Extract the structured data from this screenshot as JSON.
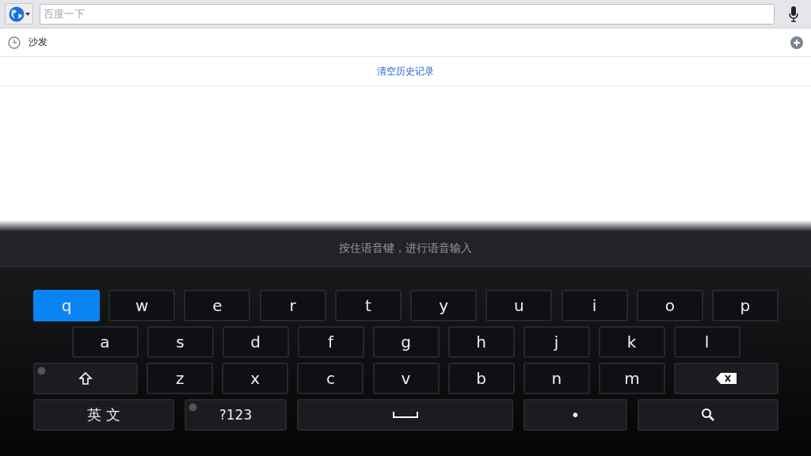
{
  "search_bar": {
    "placeholder": "百度一下"
  },
  "history": [
    {
      "text": "沙发"
    }
  ],
  "clear_history": "清空历史记录",
  "keyboard": {
    "hint": "按住语音键，进行语音输入",
    "rows": [
      {
        "keys": [
          {
            "kind": "letter",
            "label": "q",
            "pressed": true,
            "dot": false
          },
          {
            "kind": "letter",
            "label": "w",
            "pressed": false,
            "dot": false
          },
          {
            "kind": "letter",
            "label": "e",
            "pressed": false,
            "dot": false
          },
          {
            "kind": "letter",
            "label": "r",
            "pressed": false,
            "dot": false
          },
          {
            "kind": "letter",
            "label": "t",
            "pressed": false,
            "dot": false
          },
          {
            "kind": "letter",
            "label": "y",
            "pressed": false,
            "dot": false
          },
          {
            "kind": "letter",
            "label": "u",
            "pressed": false,
            "dot": false
          },
          {
            "kind": "letter",
            "label": "i",
            "pressed": false,
            "dot": false
          },
          {
            "kind": "letter",
            "label": "o",
            "pressed": false,
            "dot": false
          },
          {
            "kind": "letter",
            "label": "p",
            "pressed": false,
            "dot": false
          }
        ]
      },
      {
        "keys": [
          {
            "kind": "letter",
            "label": "a",
            "pressed": false,
            "dot": false
          },
          {
            "kind": "letter",
            "label": "s",
            "pressed": false,
            "dot": false
          },
          {
            "kind": "letter",
            "label": "d",
            "pressed": false,
            "dot": false
          },
          {
            "kind": "letter",
            "label": "f",
            "pressed": false,
            "dot": false
          },
          {
            "kind": "letter",
            "label": "g",
            "pressed": false,
            "dot": false
          },
          {
            "kind": "letter",
            "label": "h",
            "pressed": false,
            "dot": false
          },
          {
            "kind": "letter",
            "label": "j",
            "pressed": false,
            "dot": false
          },
          {
            "kind": "letter",
            "label": "k",
            "pressed": false,
            "dot": false
          },
          {
            "kind": "letter",
            "label": "l",
            "pressed": false,
            "dot": false
          }
        ]
      },
      {
        "keys": [
          {
            "kind": "shift",
            "pressed": false,
            "dot": true
          },
          {
            "kind": "letter",
            "label": "z",
            "pressed": false,
            "dot": false
          },
          {
            "kind": "letter",
            "label": "x",
            "pressed": false,
            "dot": false
          },
          {
            "kind": "letter",
            "label": "c",
            "pressed": false,
            "dot": false
          },
          {
            "kind": "letter",
            "label": "v",
            "pressed": false,
            "dot": false
          },
          {
            "kind": "letter",
            "label": "b",
            "pressed": false,
            "dot": false
          },
          {
            "kind": "letter",
            "label": "n",
            "pressed": false,
            "dot": false
          },
          {
            "kind": "letter",
            "label": "m",
            "pressed": false,
            "dot": false
          },
          {
            "kind": "backspace",
            "pressed": false,
            "dot": false
          }
        ]
      },
      {
        "keys": [
          {
            "kind": "lang",
            "label": "英 文",
            "pressed": false,
            "dot": false
          },
          {
            "kind": "symbols",
            "label": "?123",
            "pressed": false,
            "dot": true
          },
          {
            "kind": "space",
            "pressed": false,
            "dot": false
          },
          {
            "kind": "period",
            "label": "•",
            "pressed": false,
            "dot": false
          },
          {
            "kind": "search",
            "pressed": false,
            "dot": false
          }
        ]
      }
    ]
  }
}
